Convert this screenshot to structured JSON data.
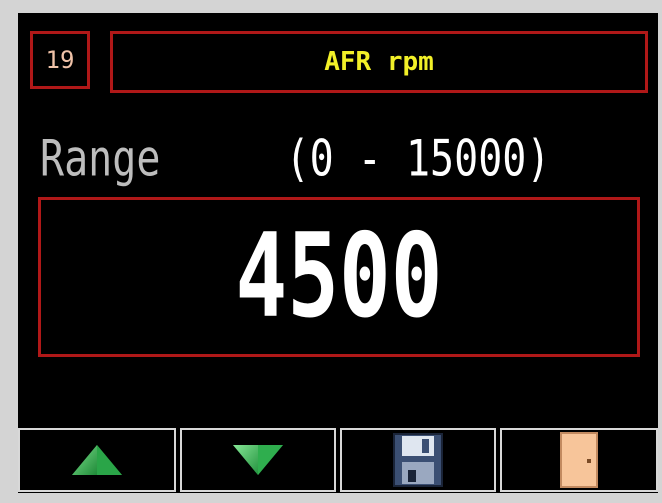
{
  "header": {
    "id_number": "19",
    "title": "AFR rpm"
  },
  "range": {
    "label": "Range",
    "value": "(0 - 15000)"
  },
  "current_value": "4500",
  "buttons": [
    {
      "name": "up-button",
      "icon": "up-arrow-icon"
    },
    {
      "name": "down-button",
      "icon": "down-arrow-icon"
    },
    {
      "name": "save-button",
      "icon": "floppy-disk-icon"
    },
    {
      "name": "exit-button",
      "icon": "door-icon"
    }
  ],
  "colors": {
    "background": "#000000",
    "border_red": "#b01818",
    "title_yellow": "#f2f028",
    "id_text": "#f0c2a8",
    "range_label": "#bdbdbd",
    "value_white": "#ffffff",
    "arrow_green": "#2ea84a",
    "door_peach": "#f7c59a"
  }
}
